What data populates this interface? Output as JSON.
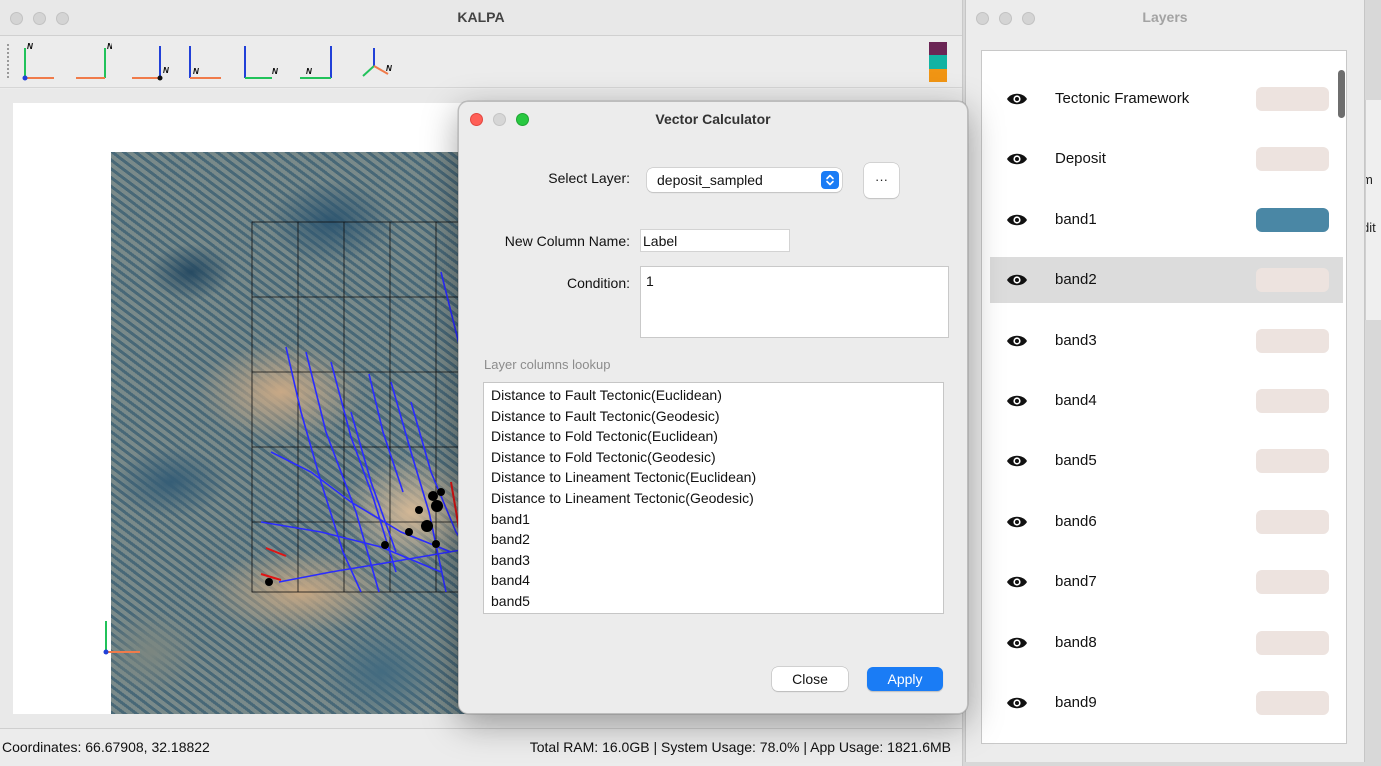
{
  "main_window": {
    "title": "KALPA",
    "toolbar": {
      "view_buttons": [
        {
          "name": "view-north-up-button",
          "icon": "axis-north-up-icon"
        },
        {
          "name": "view-north-up-right-button",
          "icon": "axis-north-right-icon"
        },
        {
          "name": "view-north-left-button",
          "icon": "axis-north-left-icon"
        },
        {
          "name": "view-north-down-right-button",
          "icon": "axis-north-down-right-icon"
        },
        {
          "name": "view-north-down-button",
          "icon": "axis-north-down-icon"
        },
        {
          "name": "view-north-back-button",
          "icon": "axis-north-back-icon"
        },
        {
          "name": "view-3d-button",
          "icon": "axis-3d-icon"
        }
      ],
      "axis_label": "N",
      "swatch_colors": [
        "#6b2555",
        "#12b3a3",
        "#f19514"
      ]
    },
    "status": {
      "coordinates": "Coordinates: 66.67908, 32.18822",
      "usage": "Total RAM: 16.0GB | System Usage: 78.0% | App Usage: 1821.6MB"
    }
  },
  "layers_window": {
    "title": "Layers",
    "layers": [
      {
        "name": "Tectonic Framework",
        "color": "#ede3df",
        "selected": false
      },
      {
        "name": "Deposit",
        "color": "#ede3df",
        "selected": false
      },
      {
        "name": "band1",
        "color": "#4a87a5",
        "selected": false
      },
      {
        "name": "band2",
        "color": "#ede3df",
        "selected": true
      },
      {
        "name": "band3",
        "color": "#ede3df",
        "selected": false
      },
      {
        "name": "band4",
        "color": "#ede3df",
        "selected": false
      },
      {
        "name": "band5",
        "color": "#ede3df",
        "selected": false
      },
      {
        "name": "band6",
        "color": "#ede3df",
        "selected": false
      },
      {
        "name": "band7",
        "color": "#ede3df",
        "selected": false
      },
      {
        "name": "band8",
        "color": "#ede3df",
        "selected": false
      },
      {
        "name": "band9",
        "color": "#ede3df",
        "selected": false
      }
    ]
  },
  "peek_window": {
    "fragment_1": "m",
    "fragment_2": "dit"
  },
  "vector_dialog": {
    "title": "Vector Calculator",
    "select_layer_label": "Select Layer:",
    "select_layer_value": "deposit_sampled",
    "more_button": "···",
    "new_column_label": "New Column Name:",
    "new_column_value": "Label",
    "condition_label": "Condition:",
    "condition_value": "1",
    "lookup_label": "Layer columns lookup",
    "lookup_items": [
      "Distance to Fault Tectonic(Euclidean)",
      "Distance to Fault Tectonic(Geodesic)",
      "Distance to Fold Tectonic(Euclidean)",
      "Distance to Fold Tectonic(Geodesic)",
      "Distance to Lineament Tectonic(Euclidean)",
      "Distance to Lineament Tectonic(Geodesic)",
      "band1",
      "band2",
      "band3",
      "band4",
      "band5"
    ],
    "close_button": "Close",
    "apply_button": "Apply",
    "accent_color": "#1a7cf5"
  }
}
